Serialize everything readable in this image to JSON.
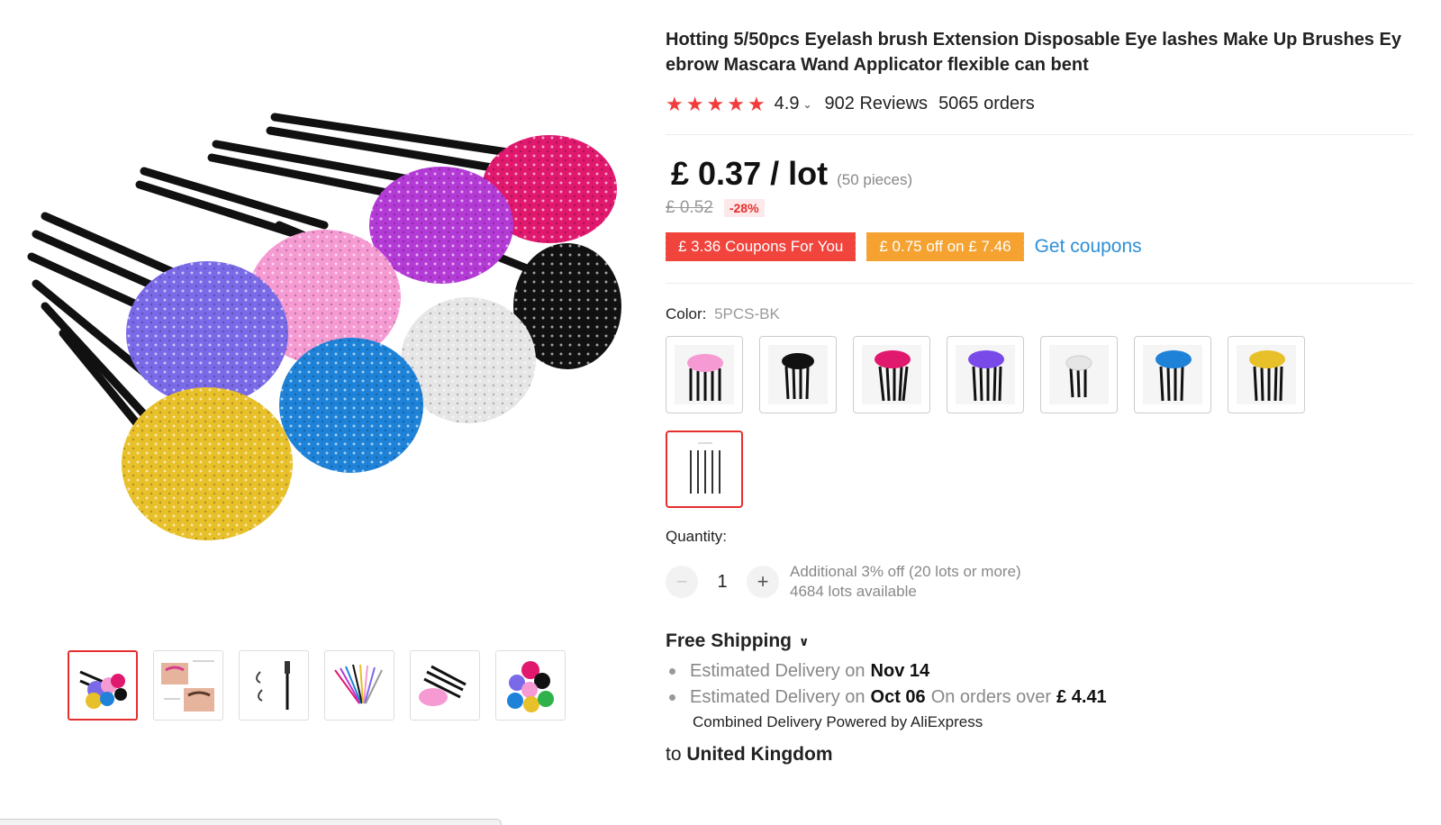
{
  "product": {
    "title": "Hotting 5/50pcs Eyelash brush Extension Disposable Eye lashes Make Up Brushes Eyebrow Mascara Wand Applicator flexible can bent",
    "rating": "4.9",
    "reviews": "902 Reviews",
    "orders": "5065 orders",
    "price": "£ 0.37 / lot",
    "pieces": "(50 pieces)",
    "original_price": "£ 0.52",
    "discount": "-28%"
  },
  "coupons": {
    "coupon1": "£ 3.36 Coupons For You",
    "coupon2": "£ 0.75 off on  £ 7.46",
    "get_coupons": "Get coupons"
  },
  "color": {
    "label": "Color:",
    "selected": "5PCS-BK",
    "options": [
      "pink",
      "black",
      "rose",
      "purple",
      "white",
      "blue",
      "yellow",
      "5pcs-black"
    ]
  },
  "quantity": {
    "label": "Quantity:",
    "value": "1",
    "minus": "−",
    "plus": "+",
    "note1": "Additional 3% off (20 lots or more)",
    "note2": "4684 lots available"
  },
  "shipping": {
    "title": "Free Shipping",
    "line1_prefix": "Estimated Delivery on",
    "line1_date": "Nov 14",
    "line2_prefix": "Estimated Delivery on",
    "line2_date": "Oct 06",
    "line2_mid": "On orders over",
    "line2_amount": "£ 4.41",
    "combined": "Combined Delivery Powered by AliExpress",
    "to_prefix": "to",
    "country": "United Kingdom"
  },
  "colors": {
    "accent_red": "#e62e2e",
    "star": "#f23c3c",
    "coupon_red": "#f0443c",
    "coupon_orange": "#f5a231",
    "link_blue": "#2e8fd6"
  }
}
